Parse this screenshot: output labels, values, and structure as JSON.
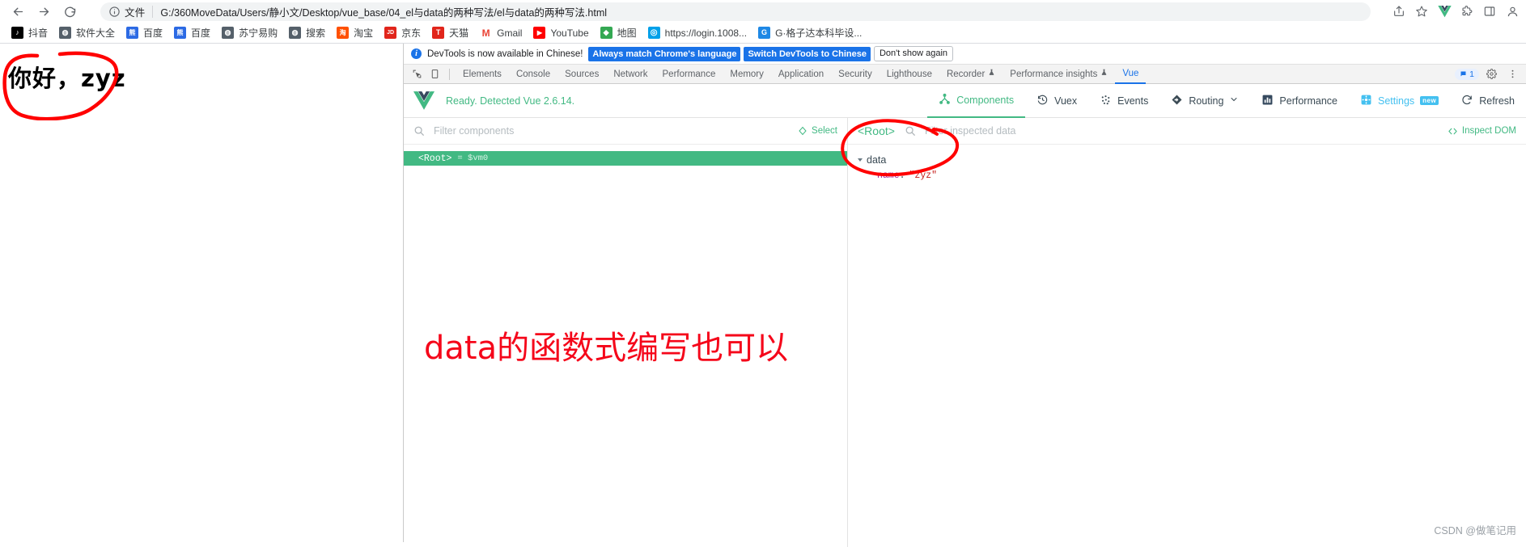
{
  "browser": {
    "nav": {
      "back": "back-arrow",
      "forward": "forward-arrow",
      "reload": "reload"
    },
    "omnibox": {
      "info_icon": "info-circle-icon",
      "scheme_label": "文件",
      "url": "G:/360MoveData/Users/静小文/Desktop/vue_base/04_el与data的两种写法/el与data的两种写法.html"
    },
    "toolbar_right": [
      {
        "name": "share-icon",
        "glyph": "share"
      },
      {
        "name": "bookmark-star-icon",
        "glyph": "star"
      },
      {
        "name": "vue-devtools-extension-icon",
        "glyph": "V",
        "color": "#42b983"
      },
      {
        "name": "extensions-puzzle-icon",
        "glyph": "puzzle"
      },
      {
        "name": "sidebar-panel-icon",
        "glyph": "panel"
      },
      {
        "name": "profile-avatar-icon",
        "glyph": "avatar"
      }
    ],
    "bookmarks": [
      {
        "label": "抖音",
        "color": "#000000",
        "glyph": "♪"
      },
      {
        "label": "软件大全",
        "color": "#4a4a4a",
        "glyph": "◍"
      },
      {
        "label": "百度",
        "color": "#2c6ae4",
        "glyph": "熊"
      },
      {
        "label": "百度",
        "color": "#2c6ae4",
        "glyph": "熊"
      },
      {
        "label": "苏宁易购",
        "color": "#4a4a4a",
        "glyph": "◍"
      },
      {
        "label": "搜索",
        "color": "#4a4a4a",
        "glyph": "◍"
      },
      {
        "label": "淘宝",
        "color": "#ff5000",
        "glyph": "淘"
      },
      {
        "label": "京东",
        "color": "#e1251b",
        "glyph": "JD"
      },
      {
        "label": "天猫",
        "color": "#e1251b",
        "glyph": "T"
      },
      {
        "label": "Gmail",
        "color": "#ea4335",
        "glyph": "M"
      },
      {
        "label": "YouTube",
        "color": "#ff0000",
        "glyph": "▶"
      },
      {
        "label": "地图",
        "color": "#34a853",
        "glyph": "📍"
      },
      {
        "label": "https://login.1008...",
        "color": "#00a0e9",
        "glyph": "◎"
      },
      {
        "label": "G·格子达本科毕设...",
        "color": "#1e88e5",
        "glyph": "G"
      }
    ]
  },
  "page": {
    "hello_text": "你好，zyz"
  },
  "devtools": {
    "message_bar": {
      "info_glyph": "i",
      "message": "DevTools is now available in Chinese!",
      "btn_always_match": "Always match Chrome's language",
      "btn_switch": "Switch DevTools to Chinese",
      "btn_dont_show": "Don't show again"
    },
    "tools": {
      "inspect_icon": "inspect-element-icon",
      "device_icon": "device-toolbar-icon"
    },
    "tabs": [
      {
        "label": "Elements",
        "active": false,
        "warn": false
      },
      {
        "label": "Console",
        "active": false,
        "warn": false
      },
      {
        "label": "Sources",
        "active": false,
        "warn": false
      },
      {
        "label": "Network",
        "active": false,
        "warn": false
      },
      {
        "label": "Performance",
        "active": false,
        "warn": false
      },
      {
        "label": "Memory",
        "active": false,
        "warn": false
      },
      {
        "label": "Application",
        "active": false,
        "warn": false
      },
      {
        "label": "Security",
        "active": false,
        "warn": false
      },
      {
        "label": "Lighthouse",
        "active": false,
        "warn": false
      },
      {
        "label": "Recorder",
        "active": false,
        "warn": true
      },
      {
        "label": "Performance insights",
        "active": false,
        "warn": true
      },
      {
        "label": "Vue",
        "active": true,
        "warn": false
      }
    ],
    "tabs_right": {
      "error_count": "1",
      "settings_icon": "gear-icon",
      "more_icon": "more-vertical-icon"
    }
  },
  "vue": {
    "logo": "vue-logo",
    "ready_text": "Ready. Detected Vue 2.6.14.",
    "actions": [
      {
        "label": "Components",
        "icon": "components-icon",
        "active": true
      },
      {
        "label": "Vuex",
        "icon": "vuex-clock-icon",
        "active": false
      },
      {
        "label": "Events",
        "icon": "events-dots-icon",
        "active": false
      },
      {
        "label": "Routing",
        "icon": "routing-icon",
        "active": false,
        "chevron": true
      },
      {
        "label": "Performance",
        "icon": "performance-bars-icon",
        "active": false
      },
      {
        "label": "Settings",
        "icon": "settings-gear-icon",
        "active": false,
        "badge": "new"
      },
      {
        "label": "Refresh",
        "icon": "refresh-icon",
        "active": false
      }
    ],
    "components_pane": {
      "search_icon": "search-icon",
      "filter_placeholder": "Filter components",
      "filter_value": "",
      "select_label": "Select",
      "select_icon": "target-icon",
      "tree": [
        {
          "tag": "<Root>",
          "vm": "= $vm0",
          "selected": true
        }
      ]
    },
    "inspector_pane": {
      "root_label": "<Root>",
      "search_icon": "search-icon",
      "filter_placeholder": "Filter inspected data",
      "filter_value": "",
      "inspect_dom_label": "Inspect DOM",
      "inspect_dom_icon": "code-brackets-icon",
      "groups": [
        {
          "name": "data",
          "expanded": true,
          "rows": [
            {
              "key": "name",
              "value": "\"zyz\""
            }
          ]
        }
      ]
    }
  },
  "annotations": {
    "red_note": "data的函数式编写也可以",
    "red_color": "#f5061a",
    "circle_hello": "circle-around-hello",
    "circle_data": "circle-around-data"
  },
  "watermark": "CSDN @做笔记用"
}
